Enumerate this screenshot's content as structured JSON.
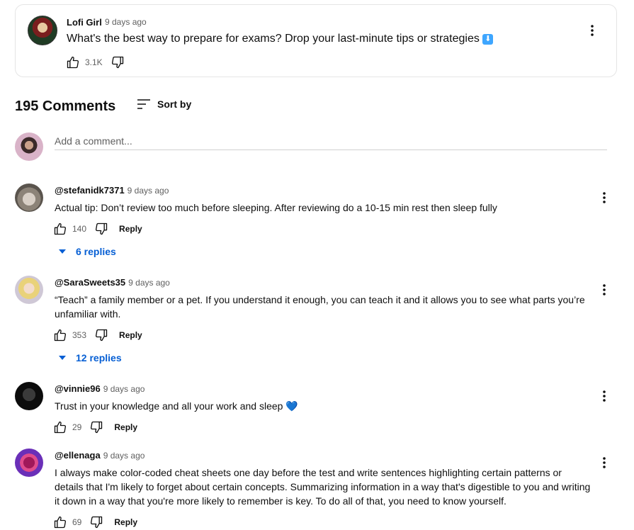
{
  "post": {
    "author": "Lofi Girl",
    "time": "9 days ago",
    "text": "What's the best way to prepare for exams? Drop your last-minute tips or strategies",
    "emoji": "⬇",
    "likes": "3.1K"
  },
  "comments_header": {
    "count_label": "195 Comments",
    "sort_label": "Sort by"
  },
  "add_comment": {
    "placeholder": "Add a comment..."
  },
  "reply_label": "Reply",
  "comments": [
    {
      "author": "@stefanidk7371",
      "time": "9 days ago",
      "text": "Actual tip: Don’t review too much before sleeping. After reviewing do a 10-15 min rest then sleep fully",
      "likes": "140",
      "replies": "6 replies"
    },
    {
      "author": "@SaraSweets35",
      "time": "9 days ago",
      "text": "“Teach” a family member or a pet. If you understand it enough, you can teach it and it allows you to see what parts you’re unfamiliar with.",
      "likes": "353",
      "replies": "12 replies"
    },
    {
      "author": "@vinnie96",
      "time": "9 days ago",
      "text": "Trust in your knowledge and all your work and sleep 💙",
      "likes": "29"
    },
    {
      "author": "@ellenaga",
      "time": "9 days ago",
      "text": "I always make color-coded cheat sheets one day before the test and write sentences highlighting certain patterns or details that I'm likely to forget about certain concepts. Summarizing information in a way that's digestible to you and writing it down in a way that you're more likely to remember is key. To do all of that, you need to know yourself.",
      "likes": "69"
    }
  ],
  "colors": {
    "link_blue": "#065fd4",
    "muted_text": "#606060",
    "emoji_blue": "#3ea6ff"
  }
}
